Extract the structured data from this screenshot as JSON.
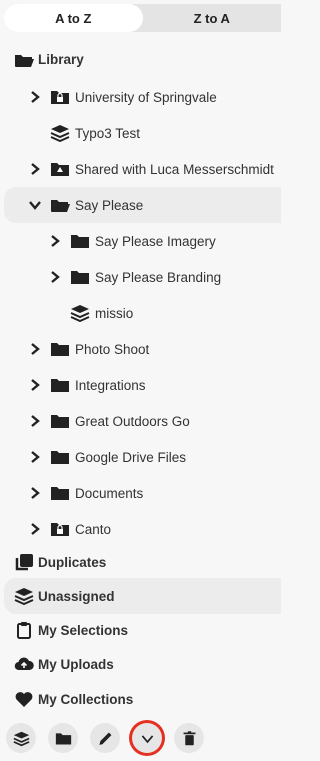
{
  "sort": {
    "az_label": "A to Z",
    "za_label": "Z to A"
  },
  "tree": {
    "library": "Library",
    "items": [
      {
        "label": "University of Springvale"
      },
      {
        "label": "Typo3 Test"
      },
      {
        "label": "Shared with Luca Messerschmidt"
      },
      {
        "label": "Say Please"
      },
      {
        "label": "Say Please Imagery"
      },
      {
        "label": "Say Please Branding"
      },
      {
        "label": "missio"
      },
      {
        "label": "Photo Shoot"
      },
      {
        "label": "Integrations"
      },
      {
        "label": "Great Outdoors Go"
      },
      {
        "label": "Google Drive Files"
      },
      {
        "label": "Documents"
      },
      {
        "label": "Canto"
      }
    ]
  },
  "sections": {
    "duplicates": "Duplicates",
    "unassigned": "Unassigned",
    "my_selections": "My Selections",
    "my_uploads": "My Uploads",
    "my_collections": "My Collections"
  },
  "colors": {
    "accent_ring": "#e53021",
    "selected_bg": "#ececec"
  }
}
